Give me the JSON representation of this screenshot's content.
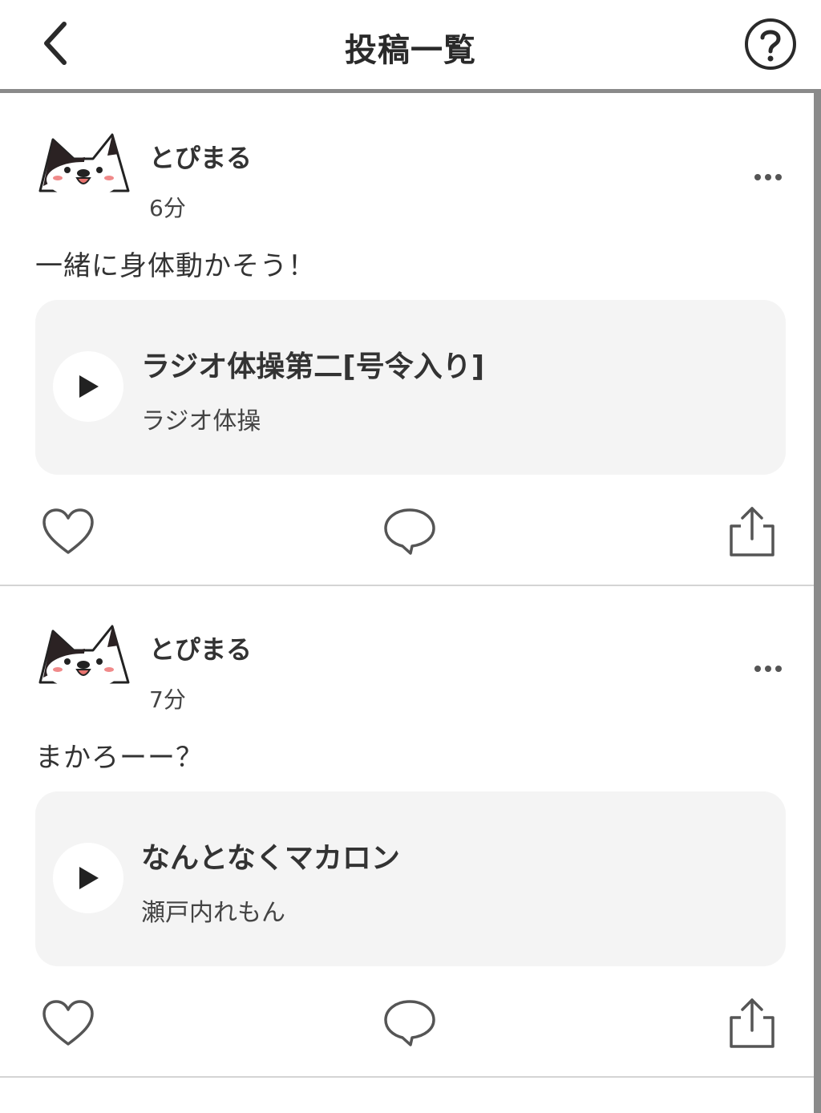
{
  "header": {
    "title": "投稿一覧",
    "back_icon": "chevron-left-icon",
    "help_icon": "question-circle-icon"
  },
  "posts": [
    {
      "username": "とぴまる",
      "time": "6分",
      "text": "一緒に身体動かそう！",
      "track": {
        "title": "ラジオ体操第二[号令入り]",
        "artist": "ラジオ体操"
      }
    },
    {
      "username": "とぴまる",
      "time": "7分",
      "text": "まかろーー？",
      "track": {
        "title": "なんとなくマカロン",
        "artist": "瀬戸内れもん"
      }
    }
  ],
  "colors": {
    "background": "#ffffff",
    "card": "#f4f4f4",
    "icon": "#555555",
    "divider": "#d4d4d4",
    "header_border": "#8a8a8a",
    "avatar_blush": "#f08a8a"
  }
}
